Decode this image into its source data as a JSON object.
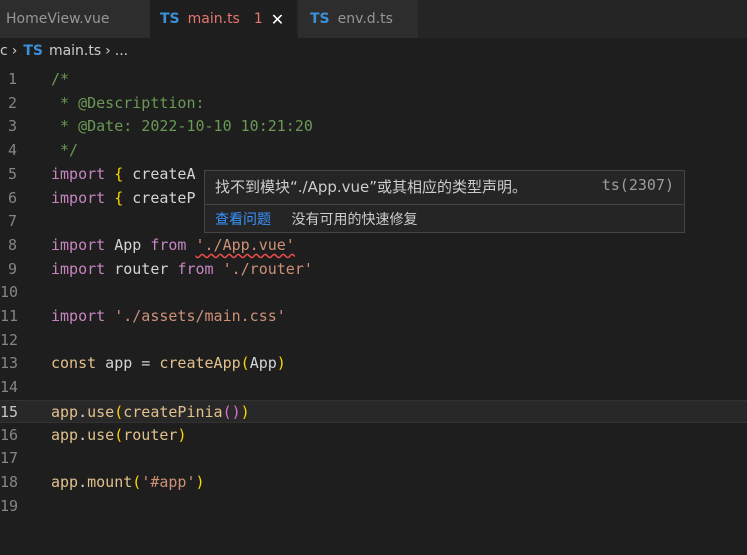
{
  "tabs": [
    {
      "label": "HomeView.vue",
      "icon": "",
      "active": false
    },
    {
      "label": "main.ts",
      "icon": "TS",
      "active": true,
      "badge": "1"
    },
    {
      "label": "env.d.ts",
      "icon": "TS",
      "active": false
    }
  ],
  "breadcrumb": {
    "prefix": "c",
    "file_icon": "TS",
    "file": "main.ts",
    "suffix": "..."
  },
  "lines": [
    {
      "n": "1",
      "segments": [
        [
          "c-comment",
          "/*"
        ]
      ]
    },
    {
      "n": "2",
      "segments": [
        [
          "c-comment",
          " * @Descripttion:"
        ]
      ]
    },
    {
      "n": "3",
      "segments": [
        [
          "c-comment",
          " * @Date: 2022-10-10 10:21:20"
        ]
      ]
    },
    {
      "n": "4",
      "segments": [
        [
          "c-comment",
          " */"
        ]
      ]
    },
    {
      "n": "5",
      "segments": [
        [
          "c-kw",
          "import"
        ],
        [
          "",
          " "
        ],
        [
          "c-b1",
          "{"
        ],
        [
          "",
          " createA"
        ]
      ]
    },
    {
      "n": "6",
      "segments": [
        [
          "c-kw",
          "import"
        ],
        [
          "",
          " "
        ],
        [
          "c-b1",
          "{"
        ],
        [
          "",
          " createP"
        ]
      ]
    },
    {
      "n": "7",
      "segments": []
    },
    {
      "n": "8",
      "segments": [
        [
          "c-kw",
          "import"
        ],
        [
          "",
          " App "
        ],
        [
          "c-kw",
          "from"
        ],
        [
          "",
          " "
        ],
        [
          "c-str squiggle",
          "'./App.vue'"
        ]
      ]
    },
    {
      "n": "9",
      "segments": [
        [
          "c-kw",
          "import"
        ],
        [
          "",
          " router "
        ],
        [
          "c-kw",
          "from"
        ],
        [
          "",
          " "
        ],
        [
          "c-str",
          "'./router'"
        ]
      ]
    },
    {
      "n": "10",
      "segments": []
    },
    {
      "n": "11",
      "segments": [
        [
          "c-kw",
          "import"
        ],
        [
          "",
          " "
        ],
        [
          "c-str",
          "'./assets/main.css'"
        ]
      ]
    },
    {
      "n": "12",
      "segments": []
    },
    {
      "n": "13",
      "segments": [
        [
          "c-yel",
          "const"
        ],
        [
          "",
          " app = "
        ],
        [
          "c-yel",
          "createApp"
        ],
        [
          "c-b1",
          "("
        ],
        [
          "",
          "App"
        ],
        [
          "c-b1",
          ")"
        ]
      ]
    },
    {
      "n": "14",
      "segments": []
    },
    {
      "n": "15",
      "current": true,
      "segments": [
        [
          "c-yel",
          "app"
        ],
        [
          "",
          "."
        ],
        [
          "c-yel",
          "use"
        ],
        [
          "c-b1",
          "("
        ],
        [
          "c-yel",
          "createPinia"
        ],
        [
          "c-b2",
          "()"
        ],
        [
          "c-b1",
          ")"
        ]
      ]
    },
    {
      "n": "16",
      "segments": [
        [
          "c-yel",
          "app"
        ],
        [
          "",
          "."
        ],
        [
          "c-yel",
          "use"
        ],
        [
          "c-b1",
          "("
        ],
        [
          "c-yel",
          "router"
        ],
        [
          "c-b1",
          ")"
        ]
      ]
    },
    {
      "n": "17",
      "segments": []
    },
    {
      "n": "18",
      "segments": [
        [
          "c-yel",
          "app"
        ],
        [
          "",
          "."
        ],
        [
          "c-yel",
          "mount"
        ],
        [
          "c-b1",
          "("
        ],
        [
          "c-str",
          "'#app'"
        ],
        [
          "c-b1",
          ")"
        ]
      ]
    },
    {
      "n": "19",
      "segments": []
    }
  ],
  "hover": {
    "message": "找不到模块“./App.vue”或其相应的类型声明。",
    "code": "ts(2307)",
    "action_link": "查看问题",
    "action_text": "没有可用的快速修复"
  },
  "colors": {
    "background": "#1e1e1e",
    "ts_icon": "#3b8fd6",
    "error": "#e5776f",
    "link": "#3794ff"
  }
}
